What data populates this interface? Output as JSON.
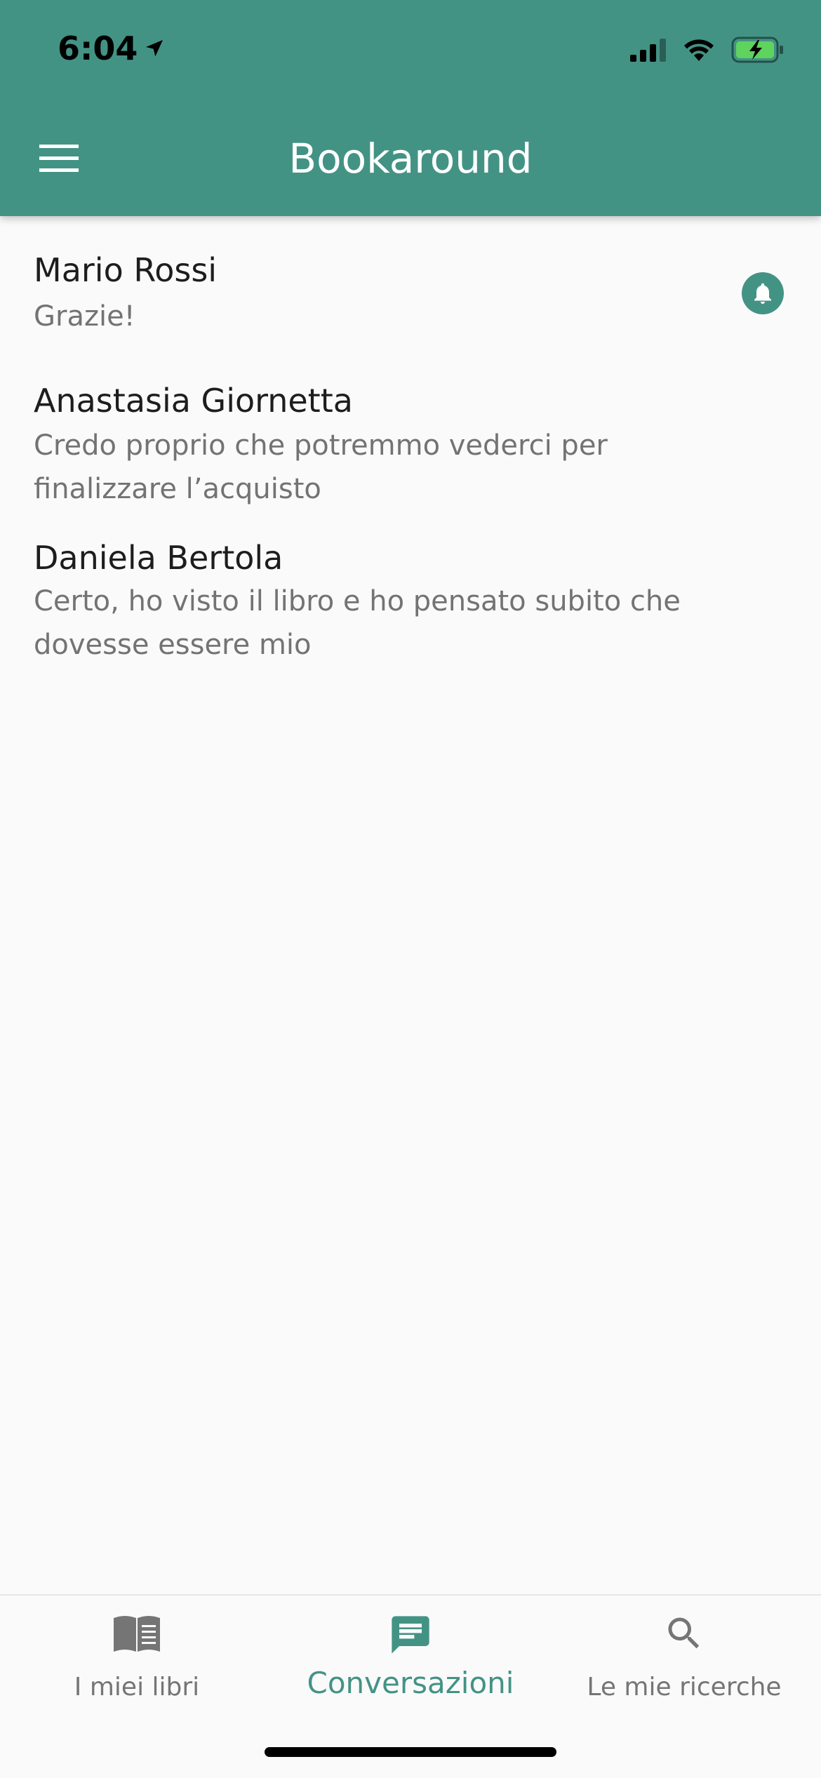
{
  "status_bar": {
    "time": "6:04"
  },
  "app_bar": {
    "title": "Bookaround"
  },
  "conversations": [
    {
      "name": "Mario Rossi",
      "message": "Grazie!",
      "has_notification": true
    },
    {
      "name": "Anastasia Giornetta",
      "message": "Credo proprio che potremmo vederci per finalizzare l’acquisto",
      "has_notification": false
    },
    {
      "name": "Daniela Bertola",
      "message": "Certo, ho visto il libro e ho pensato subito che dovesse essere mio",
      "has_notification": false
    }
  ],
  "bottom_nav": {
    "items": [
      {
        "label": "I miei libri",
        "icon": "book-icon",
        "active": false
      },
      {
        "label": "Conversazioni",
        "icon": "chat-icon",
        "active": true
      },
      {
        "label": "Le mie ricerche",
        "icon": "search-icon",
        "active": false
      }
    ]
  },
  "colors": {
    "primary": "#439385",
    "background": "#fafafa",
    "text_primary": "#1d1d1d",
    "text_secondary": "#737373",
    "nav_inactive": "#757575"
  }
}
